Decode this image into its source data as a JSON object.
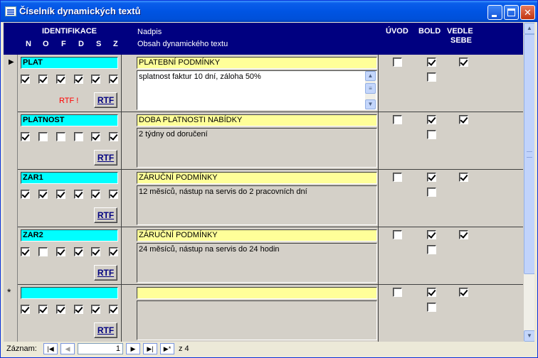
{
  "window": {
    "title": "Číselník dynamických textů"
  },
  "header": {
    "identifikace": "IDENTIFIKACE",
    "cols": [
      "N",
      "O",
      "F",
      "D",
      "S",
      "Z"
    ],
    "nadpis": "Nadpis",
    "obsah": "Obsah dynamického textu",
    "uvod": "ÚVOD",
    "bold": "BOLD",
    "vedle": "VEDLE",
    "sebe": "SEBE"
  },
  "records": [
    {
      "id": "PLAT",
      "flags": [
        true,
        true,
        true,
        true,
        true,
        true
      ],
      "heading": "PLATEBNÍ PODMÍNKY",
      "body": "splatnost faktur 10 dní, záloha 50%",
      "rtf_flag": "RTF !",
      "uvod": false,
      "bold": true,
      "bold2": false,
      "vedle": true,
      "current": true
    },
    {
      "id": "PLATNOST",
      "flags": [
        true,
        false,
        false,
        false,
        true,
        true
      ],
      "heading": "DOBA PLATNOSTI NABÍDKY",
      "body": "2 týdny od doručení",
      "rtf_flag": "",
      "uvod": false,
      "bold": true,
      "bold2": false,
      "vedle": true
    },
    {
      "id": "ZAR1",
      "flags": [
        true,
        true,
        true,
        true,
        true,
        true
      ],
      "heading": "ZÁRUČNÍ PODMÍNKY",
      "body": "12 měsíců, nástup na servis do 2 pracovních dní",
      "rtf_flag": "",
      "uvod": false,
      "bold": true,
      "bold2": false,
      "vedle": true
    },
    {
      "id": "ZAR2",
      "flags": [
        true,
        false,
        true,
        true,
        true,
        true
      ],
      "heading": "ZÁRUČNÍ PODMÍNKY",
      "body": "24 měsíců, nástup na servis do 24 hodin",
      "rtf_flag": "",
      "uvod": false,
      "bold": true,
      "bold2": false,
      "vedle": true
    },
    {
      "id": "",
      "flags": [
        true,
        true,
        true,
        true,
        true,
        true
      ],
      "heading": "",
      "body": "",
      "rtf_flag": "",
      "uvod": false,
      "bold": true,
      "bold2": false,
      "vedle": true,
      "newrec": true
    }
  ],
  "rtf_label": "RTF",
  "navigation": {
    "label": "Záznam:",
    "current": "1",
    "of": "z 4"
  }
}
